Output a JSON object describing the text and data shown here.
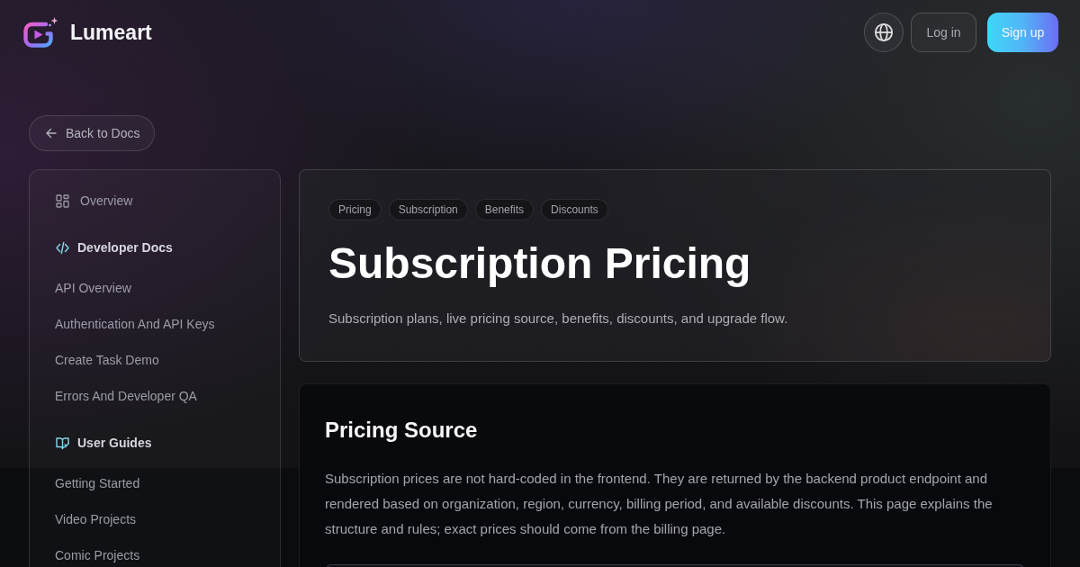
{
  "header": {
    "brand": "Lumeart",
    "login": "Log in",
    "signup": "Sign up"
  },
  "back_link": "Back to Docs",
  "sidebar": {
    "overview": "Overview",
    "sections": [
      {
        "title": "Developer Docs",
        "items": [
          "API Overview",
          "Authentication And API Keys",
          "Create Task Demo",
          "Errors And Developer QA"
        ]
      },
      {
        "title": "User Guides",
        "items": [
          "Getting Started",
          "Video Projects",
          "Comic Projects"
        ]
      }
    ]
  },
  "hero": {
    "tags": [
      "Pricing",
      "Subscription",
      "Benefits",
      "Discounts"
    ],
    "title": "Subscription Pricing",
    "description": "Subscription plans, live pricing source, benefits, discounts, and upgrade flow."
  },
  "section": {
    "heading": "Pricing Source",
    "paragraph": "Subscription prices are not hard-coded in the frontend. They are returned by the backend product endpoint and rendered based on organization, region, currency, billing period, and available discounts. This page explains the structure and rules; exact prices should come from the billing page."
  }
}
